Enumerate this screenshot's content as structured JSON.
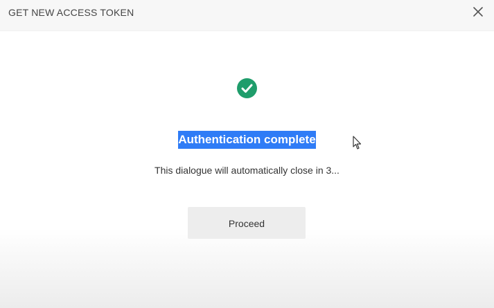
{
  "dialog": {
    "title": "GET NEW ACCESS TOKEN",
    "heading": "Authentication complete",
    "message": "This dialogue will automatically close in 3...",
    "proceed_label": "Proceed"
  },
  "icons": {
    "close": "close-icon",
    "status": "check-circle-icon",
    "cursor": "mouse-cursor-icon"
  },
  "colors": {
    "success": "#1f9d6b",
    "selection": "#2f7cf6"
  }
}
